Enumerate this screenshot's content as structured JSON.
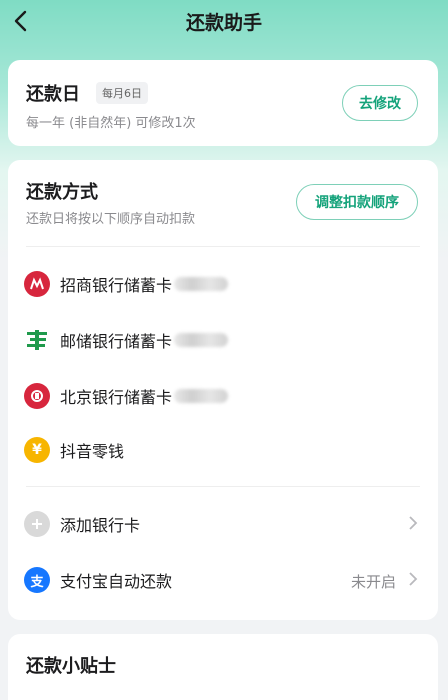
{
  "header": {
    "title": "还款助手"
  },
  "repayment_day": {
    "title": "还款日",
    "badge": "每月6日",
    "subtitle": "每一年 (非自然年) 可修改1次",
    "button": "去修改"
  },
  "method": {
    "title": "还款方式",
    "subtitle": "还款日将按以下顺序自动扣款",
    "button": "调整扣款顺序",
    "items": [
      {
        "label": "招商银行储蓄卡",
        "icon": "cmb-bank-icon"
      },
      {
        "label": "邮储银行储蓄卡",
        "icon": "psbc-bank-icon"
      },
      {
        "label": "北京银行储蓄卡",
        "icon": "bob-bank-icon"
      },
      {
        "label": "抖音零钱",
        "icon": "yuan-coin-icon"
      }
    ],
    "add_card": "添加银行卡",
    "alipay": {
      "label": "支付宝自动还款",
      "status": "未开启"
    }
  },
  "tips": {
    "title": "还款小贴士"
  },
  "colors": {
    "accent": "#15a37b",
    "accent_border": "#7ed0b8"
  }
}
